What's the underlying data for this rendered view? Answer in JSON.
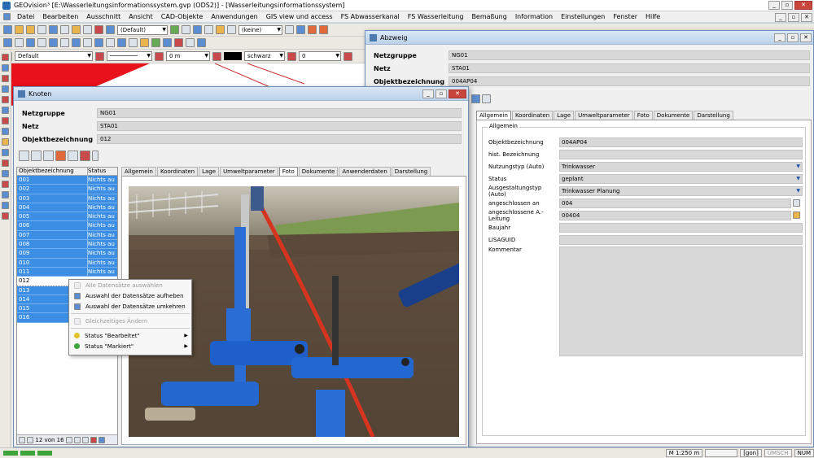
{
  "app": {
    "title": "GEOvision³  [E:\\Wasserleitungsinformationssystem.gvp (ODS2)] - [Wasserleitungsinformationssystem]"
  },
  "menu": [
    "Datei",
    "Bearbeiten",
    "Ausschnitt",
    "Ansicht",
    "CAD-Objekte",
    "Anwendungen",
    "GIS view und access",
    "FS Abwasserkanal",
    "FS Wasserleitung",
    "Bemaßung",
    "Information",
    "Einstellungen",
    "Fenster",
    "Hilfe"
  ],
  "toolbar": {
    "combo_default": "(Default)",
    "combo_keine": "(keine)",
    "style_default": "Default",
    "offset": "0 m",
    "color": "schwarz",
    "zero": "0"
  },
  "knoten": {
    "title": "Knoten",
    "fields": [
      {
        "label": "Netzgruppe",
        "value": "NG01"
      },
      {
        "label": "Netz",
        "value": "STA01"
      },
      {
        "label": "Objektbezeichnung",
        "value": "012"
      }
    ],
    "grid_head": {
      "col1": "Objektbezeichnung",
      "col2": "Status"
    },
    "rows": [
      {
        "id": "001",
        "status": "Nichts aus"
      },
      {
        "id": "002",
        "status": "Nichts aus"
      },
      {
        "id": "003",
        "status": "Nichts aus"
      },
      {
        "id": "004",
        "status": "Nichts aus"
      },
      {
        "id": "005",
        "status": "Nichts aus"
      },
      {
        "id": "006",
        "status": "Nichts aus"
      },
      {
        "id": "007",
        "status": "Nichts aus"
      },
      {
        "id": "008",
        "status": "Nichts aus"
      },
      {
        "id": "009",
        "status": "Nichts aus"
      },
      {
        "id": "010",
        "status": "Nichts aus"
      },
      {
        "id": "011",
        "status": "Nichts aus"
      },
      {
        "id": "012",
        "status": ""
      },
      {
        "id": "013",
        "status": ""
      },
      {
        "id": "014",
        "status": ""
      },
      {
        "id": "015",
        "status": ""
      },
      {
        "id": "016",
        "status": ""
      }
    ],
    "nav_counter": "12 von 16",
    "tabs": [
      "Allgemein",
      "Koordinaten",
      "Lage",
      "Umweltparameter",
      "Foto",
      "Dokumente",
      "Anwenderdaten",
      "Darstellung"
    ],
    "active_tab": "Foto"
  },
  "context_menu": {
    "items": [
      {
        "label": "Alle Datensätze auswählen",
        "disabled": true
      },
      {
        "label": "Auswahl der Datensätze aufheben",
        "disabled": false
      },
      {
        "label": "Auswahl der Datensätze umkehren",
        "disabled": false
      },
      {
        "label": "Gleichzeitiges Ändern",
        "disabled": true
      },
      {
        "label": "Status \"Bearbeitet\"",
        "disabled": false
      },
      {
        "label": "Status \"Markiert\"",
        "disabled": false
      }
    ]
  },
  "abzweig": {
    "title": "Abzweig",
    "fields": [
      {
        "label": "Netzgruppe",
        "value": "NG01"
      },
      {
        "label": "Netz",
        "value": "STA01"
      },
      {
        "label": "Objektbezeichnung",
        "value": "004AP04"
      }
    ],
    "tabs": [
      "Allgemein",
      "Koordinaten",
      "Lage",
      "Umweltparameter",
      "Foto",
      "Dokumente",
      "Darstellung"
    ],
    "active_tab": "Allgemein",
    "group_title": "Allgemein",
    "attrs": [
      {
        "label": "Objektbezeichnung",
        "value": "004AP04"
      },
      {
        "label": "hist. Bezeichnung",
        "value": ""
      },
      {
        "label": "Nutzungstyp (Auto)",
        "value": "Trinkwasser"
      },
      {
        "label": "Status",
        "value": "geplant"
      },
      {
        "label": "Ausgestaltungstyp (Auto)",
        "value": "Trinkwasser Planung"
      },
      {
        "label": "angeschlossen an",
        "value": "004"
      },
      {
        "label": "angeschlossene A.-Leitung",
        "value": "00404"
      },
      {
        "label": "Baujahr",
        "value": ""
      },
      {
        "label": "LISAGUID",
        "value": ""
      },
      {
        "label": "Kommentar",
        "value": ""
      }
    ]
  },
  "status": {
    "scale": "M 1:250",
    "unit": "m",
    "angle": "[gon]",
    "umsch": "UMSCH",
    "num": "NUM"
  },
  "colors": {
    "selection": "#3b8ee3",
    "map_red": "#e8121a",
    "window_border": "#6d8fb5"
  }
}
